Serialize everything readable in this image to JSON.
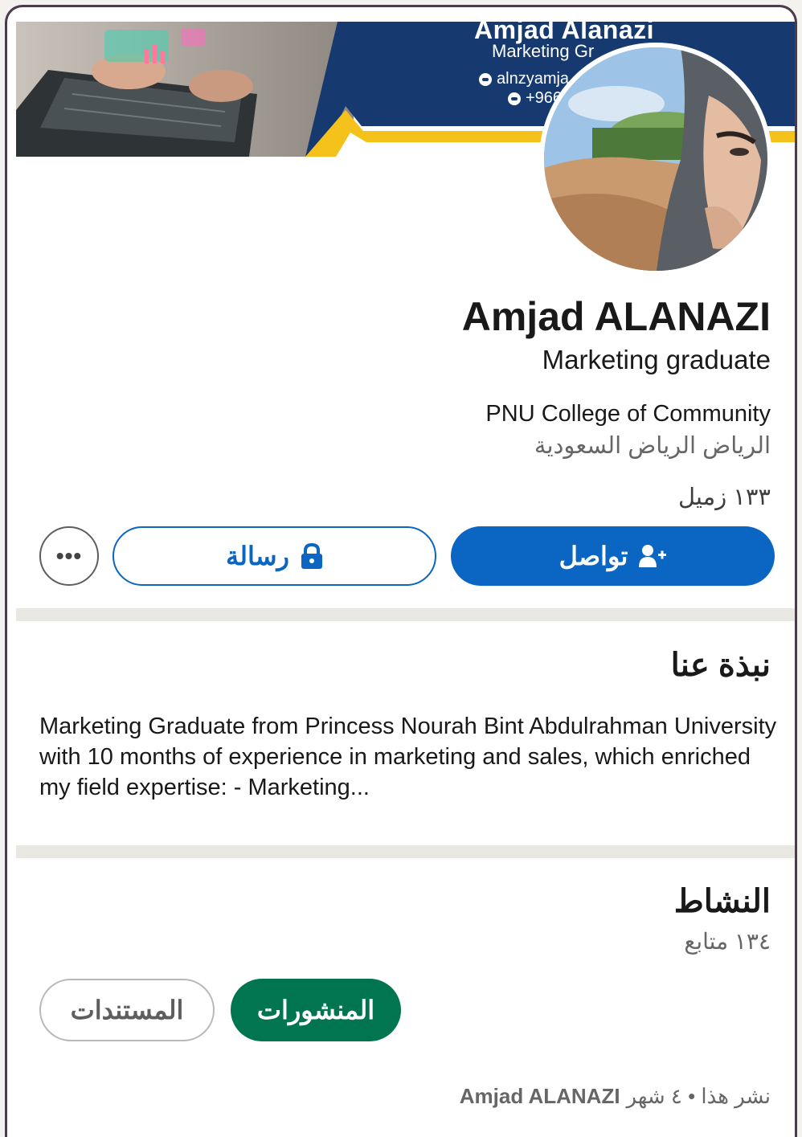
{
  "banner": {
    "name": "Amjad Alanazi",
    "role": "Marketing Gr",
    "email": "alnzyamja",
    "phone": "+966",
    "colors": {
      "navy": "#163a70",
      "yellow": "#f4c21a"
    }
  },
  "profile": {
    "name": "Amjad ALANAZI",
    "headline": "Marketing graduate",
    "school": "PNU College of Community",
    "location": "الرياض الرياض السعودية",
    "connections": "١٣٣ زميل"
  },
  "actions": {
    "connect_label": "تواصل",
    "message_label": "رسالة",
    "more_label": "•••"
  },
  "about": {
    "title": "نبذة عنا",
    "text": "Marketing Graduate from Princess Nourah Bint Abdulrahman University with 10 months of experience in marketing and sales, which enriched my field expertise: - Marketing..."
  },
  "activity": {
    "title": "النشاط",
    "followers": "١٣٤ متابع",
    "tabs": [
      {
        "label": "المنشورات",
        "active": true
      },
      {
        "label": "المستندات",
        "active": false
      }
    ],
    "post_meta_prefix": "نشر هذا • ٤ شهر",
    "post_author": "Amjad ALANAZI"
  },
  "colors": {
    "primary": "#0a66c2",
    "active_tab": "#01754f",
    "divider": "#e9e7e2"
  }
}
